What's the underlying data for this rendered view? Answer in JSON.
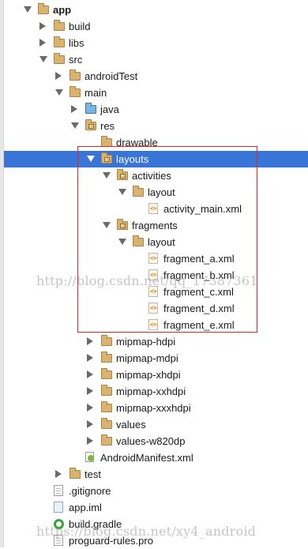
{
  "tree": {
    "selected_color": "#3875d7",
    "rows": [
      {
        "label": "app",
        "depth": 0,
        "expanded": true,
        "icon": "folder-icon",
        "bold": true
      },
      {
        "label": "build",
        "depth": 1,
        "expanded": false,
        "icon": "folder-icon"
      },
      {
        "label": "libs",
        "depth": 1,
        "expanded": false,
        "icon": "folder-icon"
      },
      {
        "label": "src",
        "depth": 1,
        "expanded": true,
        "icon": "folder-icon"
      },
      {
        "label": "androidTest",
        "depth": 2,
        "expanded": false,
        "icon": "folder-icon"
      },
      {
        "label": "main",
        "depth": 2,
        "expanded": true,
        "icon": "folder-icon"
      },
      {
        "label": "java",
        "depth": 3,
        "expanded": false,
        "icon": "source-folder-icon"
      },
      {
        "label": "res",
        "depth": 3,
        "expanded": true,
        "icon": "resource-folder-icon"
      },
      {
        "label": "drawable",
        "depth": 4,
        "expanded": null,
        "icon": "folder-icon"
      },
      {
        "label": "layouts",
        "depth": 4,
        "expanded": true,
        "icon": "resource-folder-icon",
        "selected": true
      },
      {
        "label": "activities",
        "depth": 5,
        "expanded": true,
        "icon": "resource-folder-icon"
      },
      {
        "label": "layout",
        "depth": 6,
        "expanded": true,
        "icon": "folder-icon"
      },
      {
        "label": "activity_main.xml",
        "depth": 7,
        "expanded": null,
        "icon": "xml-file-icon"
      },
      {
        "label": "fragments",
        "depth": 5,
        "expanded": true,
        "icon": "resource-folder-icon"
      },
      {
        "label": "layout",
        "depth": 6,
        "expanded": true,
        "icon": "folder-icon"
      },
      {
        "label": "fragment_a.xml",
        "depth": 7,
        "expanded": null,
        "icon": "xml-file-icon"
      },
      {
        "label": "fragment_b.xml",
        "depth": 7,
        "expanded": null,
        "icon": "xml-file-icon"
      },
      {
        "label": "fragment_c.xml",
        "depth": 7,
        "expanded": null,
        "icon": "xml-file-icon"
      },
      {
        "label": "fragment_d.xml",
        "depth": 7,
        "expanded": null,
        "icon": "xml-file-icon"
      },
      {
        "label": "fragment_e.xml",
        "depth": 7,
        "expanded": null,
        "icon": "xml-file-icon"
      },
      {
        "label": "mipmap-hdpi",
        "depth": 4,
        "expanded": false,
        "icon": "folder-icon"
      },
      {
        "label": "mipmap-mdpi",
        "depth": 4,
        "expanded": false,
        "icon": "folder-icon"
      },
      {
        "label": "mipmap-xhdpi",
        "depth": 4,
        "expanded": false,
        "icon": "folder-icon"
      },
      {
        "label": "mipmap-xxhdpi",
        "depth": 4,
        "expanded": false,
        "icon": "folder-icon"
      },
      {
        "label": "mipmap-xxxhdpi",
        "depth": 4,
        "expanded": false,
        "icon": "folder-icon"
      },
      {
        "label": "values",
        "depth": 4,
        "expanded": false,
        "icon": "folder-icon"
      },
      {
        "label": "values-w820dp",
        "depth": 4,
        "expanded": false,
        "icon": "folder-icon"
      },
      {
        "label": "AndroidManifest.xml",
        "depth": 3,
        "expanded": null,
        "icon": "manifest-file-icon"
      },
      {
        "label": "test",
        "depth": 2,
        "expanded": false,
        "icon": "folder-icon"
      },
      {
        "label": ".gitignore",
        "depth": 1,
        "expanded": null,
        "icon": "text-file-icon"
      },
      {
        "label": "app.iml",
        "depth": 1,
        "expanded": null,
        "icon": "iml-file-icon"
      },
      {
        "label": "build.gradle",
        "depth": 1,
        "expanded": null,
        "icon": "gradle-file-icon"
      },
      {
        "label": "proguard-rules.pro",
        "depth": 1,
        "expanded": null,
        "icon": "text-file-icon"
      }
    ]
  },
  "watermarks": {
    "middle": "http://blog.csdn.net/qq_17387361",
    "bottom": "https://blog.csdn.net/xy4_android"
  }
}
